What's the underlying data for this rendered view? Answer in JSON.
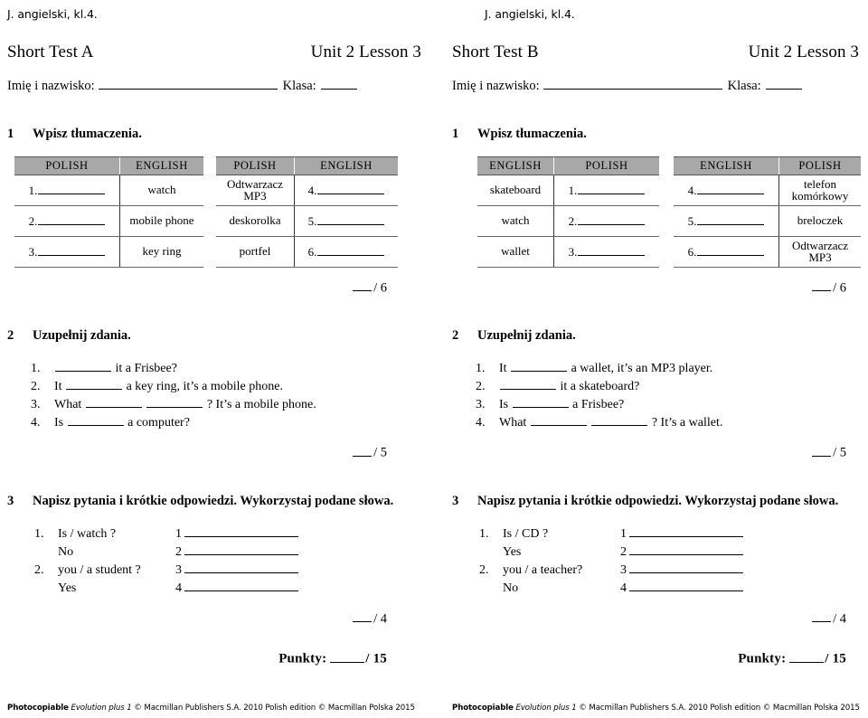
{
  "document": {
    "slug": "J. angielski, kl.4.",
    "footer": {
      "bold": "Photocopiable",
      "italic": "Evolution plus 1",
      "rest": "© Macmillan Publishers S.A. 2010 Polish edition © Macmillan Polska 2015"
    },
    "labels": {
      "name_label": "Imię i nazwisko:",
      "class_label": "Klasa:",
      "punkty_label": "Punkty:",
      "punkty_total": "/ 15"
    }
  },
  "tests": [
    {
      "title": "Short Test A",
      "unit": "Unit 2 Lesson 3",
      "exercises": [
        {
          "number": "1",
          "title": "Wpisz tłumaczenia.",
          "score": "/ 6",
          "tables": [
            {
              "headers": [
                "POLISH",
                "ENGLISH"
              ],
              "rows": [
                {
                  "left": {
                    "type": "blank",
                    "num": "1."
                  },
                  "right": {
                    "type": "text",
                    "text": "watch"
                  }
                },
                {
                  "left": {
                    "type": "blank",
                    "num": "2."
                  },
                  "right": {
                    "type": "text",
                    "text": "mobile phone"
                  }
                },
                {
                  "left": {
                    "type": "blank",
                    "num": "3."
                  },
                  "right": {
                    "type": "text",
                    "text": "key ring"
                  }
                }
              ]
            },
            {
              "headers": [
                "POLISH",
                "ENGLISH"
              ],
              "rows": [
                {
                  "left": {
                    "type": "text",
                    "text": "Odtwarzacz MP3"
                  },
                  "right": {
                    "type": "blank",
                    "num": "4."
                  }
                },
                {
                  "left": {
                    "type": "text",
                    "text": "deskorolka"
                  },
                  "right": {
                    "type": "blank",
                    "num": "5."
                  }
                },
                {
                  "left": {
                    "type": "text",
                    "text": "portfel"
                  },
                  "right": {
                    "type": "blank",
                    "num": "6."
                  }
                }
              ]
            }
          ]
        },
        {
          "number": "2",
          "title": "Uzupełnij zdania.",
          "score": "/ 5",
          "sentences": [
            {
              "n": "1.",
              "parts": [
                "gap",
                " it a Frisbee?"
              ]
            },
            {
              "n": "2.",
              "parts": [
                "It ",
                "gap",
                " a key ring, it’s a mobile phone."
              ]
            },
            {
              "n": "3.",
              "parts": [
                "What ",
                "gap",
                "  ",
                "gap",
                " ? It’s a mobile phone."
              ]
            },
            {
              "n": "4.",
              "parts": [
                "Is ",
                "gap",
                " a computer?"
              ]
            }
          ]
        },
        {
          "number": "3",
          "title": "Napisz pytania i krótkie odpowiedzi. Wykorzystaj podane słowa.",
          "score": "/ 4",
          "qa": [
            {
              "n": "1.",
              "prompt": "Is / watch ?",
              "idx": "1"
            },
            {
              "n": "",
              "prompt": "No",
              "idx": "2"
            },
            {
              "n": "2.",
              "prompt": "you / a student ?",
              "idx": "3"
            },
            {
              "n": "",
              "prompt": "Yes",
              "idx": "4"
            }
          ]
        }
      ]
    },
    {
      "title": "Short Test B",
      "unit": "Unit 2 Lesson 3",
      "exercises": [
        {
          "number": "1",
          "title": "Wpisz tłumaczenia.",
          "score": "/ 6",
          "tables": [
            {
              "headers": [
                "ENGLISH",
                "POLISH"
              ],
              "rows": [
                {
                  "left": {
                    "type": "text",
                    "text": "skateboard"
                  },
                  "right": {
                    "type": "blank",
                    "num": "1."
                  }
                },
                {
                  "left": {
                    "type": "text",
                    "text": "watch"
                  },
                  "right": {
                    "type": "blank",
                    "num": "2."
                  }
                },
                {
                  "left": {
                    "type": "text",
                    "text": "wallet"
                  },
                  "right": {
                    "type": "blank",
                    "num": "3."
                  }
                }
              ]
            },
            {
              "headers": [
                "ENGLISH",
                "POLISH"
              ],
              "rows": [
                {
                  "left": {
                    "type": "blank",
                    "num": "4."
                  },
                  "right": {
                    "type": "text",
                    "text": "telefon komórkowy"
                  }
                },
                {
                  "left": {
                    "type": "blank",
                    "num": "5."
                  },
                  "right": {
                    "type": "text",
                    "text": "breloczek"
                  }
                },
                {
                  "left": {
                    "type": "blank",
                    "num": "6."
                  },
                  "right": {
                    "type": "text",
                    "text": "Odtwarzacz MP3"
                  }
                }
              ]
            }
          ]
        },
        {
          "number": "2",
          "title": "Uzupełnij zdania.",
          "score": "/ 5",
          "sentences": [
            {
              "n": "1.",
              "parts": [
                "It ",
                "gap",
                " a wallet, it’s an MP3 player."
              ]
            },
            {
              "n": "2.",
              "parts": [
                "gap",
                " it a skateboard?"
              ]
            },
            {
              "n": "3.",
              "parts": [
                "Is ",
                "gap",
                " a Frisbee?"
              ]
            },
            {
              "n": "4.",
              "parts": [
                "What ",
                "gap",
                "  ",
                "gap",
                " ? It’s a wallet."
              ]
            }
          ]
        },
        {
          "number": "3",
          "title": "Napisz pytania i krótkie odpowiedzi. Wykorzystaj podane słowa.",
          "score": "/ 4",
          "qa": [
            {
              "n": "1.",
              "prompt": "Is / CD ?",
              "idx": "1"
            },
            {
              "n": "",
              "prompt": "Yes",
              "idx": "2"
            },
            {
              "n": "2.",
              "prompt": "you / a teacher?",
              "idx": "3"
            },
            {
              "n": "",
              "prompt": "No",
              "idx": "4"
            }
          ]
        }
      ]
    }
  ]
}
